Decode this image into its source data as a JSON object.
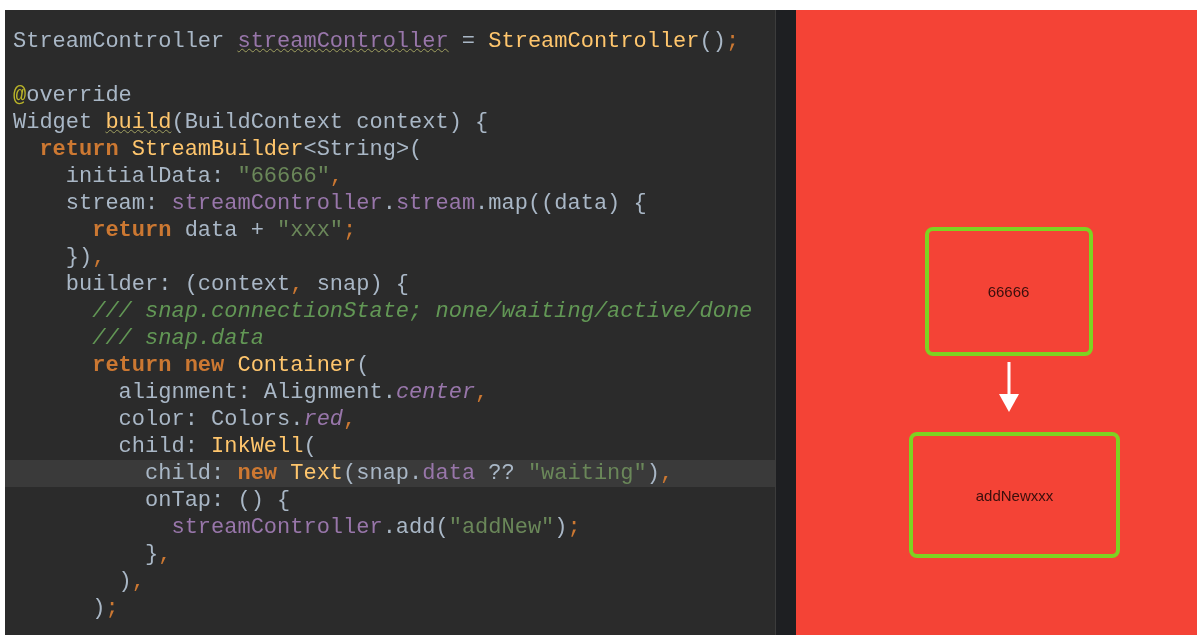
{
  "editor": {
    "lines": [
      {
        "current": false,
        "tokens": [
          {
            "kind": "plain",
            "text": "StreamController "
          },
          {
            "kind": "field_warn",
            "text": "streamController"
          },
          {
            "kind": "plain",
            "text": " = "
          },
          {
            "kind": "type",
            "text": "StreamController"
          },
          {
            "kind": "plain",
            "text": "()"
          },
          {
            "kind": "punct",
            "text": ";"
          }
        ]
      },
      {
        "current": false
      },
      {
        "current": false,
        "tokens": [
          {
            "kind": "annotation",
            "text": "@"
          },
          {
            "kind": "plain",
            "text": "override"
          }
        ]
      },
      {
        "current": false,
        "tokens": [
          {
            "kind": "plain",
            "text": "Widget "
          },
          {
            "kind": "type_warn",
            "text": "build"
          },
          {
            "kind": "plain",
            "text": "(BuildContext context) {"
          }
        ]
      },
      {
        "current": false,
        "tokens": [
          {
            "kind": "keyword",
            "text": "  return "
          },
          {
            "kind": "type",
            "text": "StreamBuilder"
          },
          {
            "kind": "plain",
            "text": "<String>("
          }
        ]
      },
      {
        "current": false,
        "tokens": [
          {
            "kind": "plain",
            "text": "    initialData: "
          },
          {
            "kind": "string",
            "text": "\"66666\""
          },
          {
            "kind": "punct",
            "text": ","
          }
        ]
      },
      {
        "current": false,
        "tokens": [
          {
            "kind": "plain",
            "text": "    stream: "
          },
          {
            "kind": "field",
            "text": "streamController"
          },
          {
            "kind": "plain",
            "text": "."
          },
          {
            "kind": "field",
            "text": "stream"
          },
          {
            "kind": "plain",
            "text": ".map((data) {"
          }
        ]
      },
      {
        "current": false,
        "tokens": [
          {
            "kind": "keyword",
            "text": "      return "
          },
          {
            "kind": "plain",
            "text": "data + "
          },
          {
            "kind": "string",
            "text": "\"xxx\""
          },
          {
            "kind": "punct",
            "text": ";"
          }
        ]
      },
      {
        "current": false,
        "tokens": [
          {
            "kind": "plain",
            "text": "    })"
          },
          {
            "kind": "punct",
            "text": ","
          }
        ]
      },
      {
        "current": false,
        "tokens": [
          {
            "kind": "plain",
            "text": "    builder: (context"
          },
          {
            "kind": "punct",
            "text": ","
          },
          {
            "kind": "plain",
            "text": " snap) {"
          }
        ]
      },
      {
        "current": false,
        "tokens": [
          {
            "kind": "comment",
            "text": "      /// snap.connectionState; none/waiting/active/done"
          }
        ]
      },
      {
        "current": false,
        "tokens": [
          {
            "kind": "comment",
            "text": "      /// snap.data"
          }
        ]
      },
      {
        "current": false,
        "tokens": [
          {
            "kind": "keyword",
            "text": "      return new "
          },
          {
            "kind": "type",
            "text": "Container"
          },
          {
            "kind": "plain",
            "text": "("
          }
        ]
      },
      {
        "current": false,
        "tokens": [
          {
            "kind": "plain",
            "text": "        alignment: Alignment."
          },
          {
            "kind": "constant",
            "text": "center"
          },
          {
            "kind": "punct",
            "text": ","
          }
        ]
      },
      {
        "current": false,
        "tokens": [
          {
            "kind": "plain",
            "text": "        color: Colors."
          },
          {
            "kind": "constant",
            "text": "red"
          },
          {
            "kind": "punct",
            "text": ","
          }
        ]
      },
      {
        "current": false,
        "tokens": [
          {
            "kind": "plain",
            "text": "        child: "
          },
          {
            "kind": "type",
            "text": "InkWell"
          },
          {
            "kind": "plain",
            "text": "("
          }
        ]
      },
      {
        "current": true,
        "tokens": [
          {
            "kind": "plain",
            "text": "          child: "
          },
          {
            "kind": "keyword",
            "text": "new "
          },
          {
            "kind": "type",
            "text": "Text"
          },
          {
            "kind": "plain",
            "text": "(snap."
          },
          {
            "kind": "field",
            "text": "data"
          },
          {
            "kind": "plain",
            "text": " ?? "
          },
          {
            "kind": "string",
            "text": "\"waiting\""
          },
          {
            "kind": "plain",
            "text": ")"
          },
          {
            "kind": "punct",
            "text": ","
          }
        ]
      },
      {
        "current": false,
        "tokens": [
          {
            "kind": "plain",
            "text": "          onTap: () {"
          }
        ]
      },
      {
        "current": false,
        "tokens": [
          {
            "kind": "field",
            "text": "            streamController"
          },
          {
            "kind": "plain",
            "text": ".add("
          },
          {
            "kind": "string",
            "text": "\"addNew\""
          },
          {
            "kind": "plain",
            "text": ")"
          },
          {
            "kind": "punct",
            "text": ";"
          }
        ]
      },
      {
        "current": false,
        "tokens": [
          {
            "kind": "plain",
            "text": "          }"
          },
          {
            "kind": "punct",
            "text": ","
          }
        ]
      },
      {
        "current": false,
        "tokens": [
          {
            "kind": "plain",
            "text": "        )"
          },
          {
            "kind": "punct",
            "text": ","
          }
        ]
      },
      {
        "current": false,
        "tokens": [
          {
            "kind": "plain",
            "text": "      )"
          },
          {
            "kind": "punct",
            "text": ";"
          }
        ]
      }
    ]
  },
  "preview": {
    "boxes": [
      {
        "text": "66666"
      },
      {
        "text": "addNewxxx"
      }
    ]
  }
}
